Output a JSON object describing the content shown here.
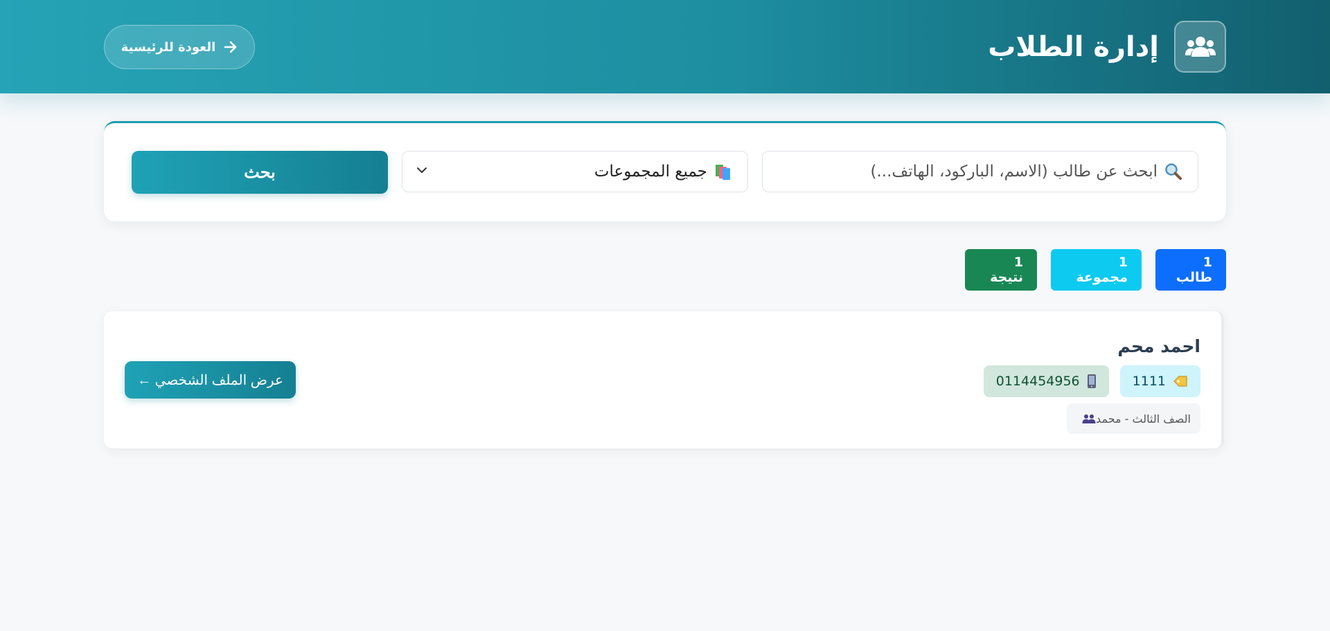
{
  "header": {
    "title": "إدارة الطلاب",
    "back_label": "العودة للرئيسية",
    "icon": "users-icon"
  },
  "search": {
    "placeholder": "ابحث عن طالب (الاسم، الباركود، الهاتف...)",
    "value": "",
    "search_icon": "magnifier-icon",
    "group_select": {
      "selected": "جميع المجموعات",
      "icon": "books-icon"
    },
    "button_label": "بحث"
  },
  "stats": {
    "students": "1 طالب",
    "groups": "1 مجموعة",
    "results": "1 نتيجة"
  },
  "students": [
    {
      "name": "احمد محم",
      "barcode": "1111",
      "phone": "0114454956",
      "group": "الصف الثالث - محمد",
      "profile_button": "عرض الملف الشخصي ←"
    }
  ],
  "colors": {
    "primary": "#1e9bb0",
    "students_badge": "#0d6efd",
    "groups_badge": "#0dcaf0",
    "results_badge": "#198754"
  }
}
